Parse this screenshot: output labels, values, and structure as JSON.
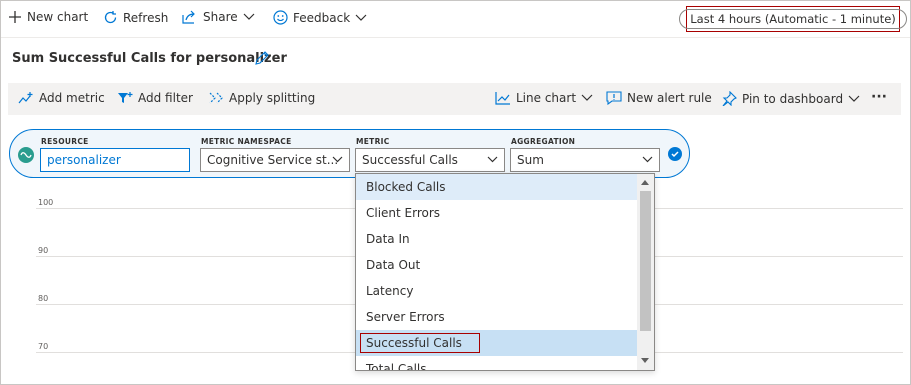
{
  "toolbar": {
    "new_chart": "New chart",
    "refresh": "Refresh",
    "share": "Share",
    "feedback": "Feedback",
    "time_range": "Last 4 hours (Automatic - 1 minute)"
  },
  "chart_title": "Sum Successful Calls for personalizer",
  "chart_toolbar": {
    "add_metric": "Add metric",
    "add_filter": "Add filter",
    "apply_splitting": "Apply splitting",
    "line_chart": "Line chart",
    "new_alert_rule": "New alert rule",
    "pin_to_dashboard": "Pin to dashboard",
    "more": "···"
  },
  "metric_selector": {
    "resource_label": "RESOURCE",
    "resource_value": "personalizer",
    "namespace_label": "METRIC NAMESPACE",
    "namespace_value": "Cognitive Service st...",
    "metric_label": "METRIC",
    "metric_value": "Successful Calls",
    "aggregation_label": "AGGREGATION",
    "aggregation_value": "Sum"
  },
  "y_axis_ticks": [
    "100",
    "90",
    "80",
    "70"
  ],
  "metric_options": [
    "Blocked Calls",
    "Client Errors",
    "Data In",
    "Data Out",
    "Latency",
    "Server Errors",
    "Successful Calls",
    "Total Calls"
  ],
  "colors": {
    "accent": "#0078d4",
    "highlight_border": "#a80000"
  }
}
